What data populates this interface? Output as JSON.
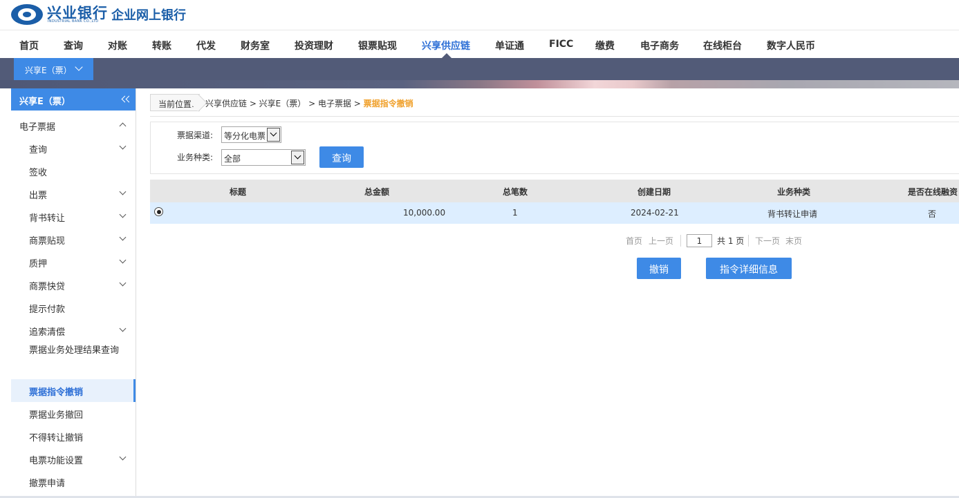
{
  "header": {
    "logo_cn": "兴业银行",
    "logo_en": "INDUSTRIAL BANK CO.,LTD",
    "app_title": "企业网上银行"
  },
  "topnav": {
    "items": [
      "首页",
      "查询",
      "对账",
      "转账",
      "代发",
      "财务室",
      "投资理财",
      "银票贴现",
      "兴享供应链",
      "单证通",
      "FICC",
      "缴费",
      "电子商务",
      "在线柜台",
      "数字人民币"
    ],
    "active": "兴享供应链"
  },
  "subtab": {
    "label": "兴享E（票）"
  },
  "sidebar": {
    "title": "兴享E（票）",
    "items": [
      {
        "label": "电子票据"
      },
      {
        "label": "查询"
      },
      {
        "label": "签收"
      },
      {
        "label": "出票"
      },
      {
        "label": "背书转让"
      },
      {
        "label": "商票贴现"
      },
      {
        "label": "质押"
      },
      {
        "label": "商票快贷"
      },
      {
        "label": "提示付款"
      },
      {
        "label": "追索清偿"
      },
      {
        "label": "票据业务处理结果查询"
      },
      {
        "label": "票据指令撤销"
      },
      {
        "label": "票据业务撤回"
      },
      {
        "label": "不得转让撤销"
      },
      {
        "label": "电票功能设置"
      },
      {
        "label": "撤票申请"
      }
    ]
  },
  "breadcrumb": {
    "label": "当前位置:",
    "path": "兴享供应链 > 兴享E（票） > 电子票据 > ",
    "current": "票据指令撤销"
  },
  "query": {
    "channel_label": "票据渠道:",
    "channel_value": "等分化电票",
    "biztype_label": "业务种类:",
    "biztype_value": "全部",
    "search_button": "查询"
  },
  "table": {
    "columns": [
      "标题",
      "总金额",
      "总笔数",
      "创建日期",
      "业务种类",
      "是否在线融资"
    ],
    "rows": [
      {
        "title": "",
        "amount": "10,000.00",
        "count": "1",
        "date": "2024-02-21",
        "biz_type": "背书转让申请",
        "online_finance": "否"
      }
    ]
  },
  "pager": {
    "first": "首页",
    "prev": "上一页",
    "current_page": "1",
    "total": "共 1 页",
    "next": "下一页",
    "last": "末页"
  },
  "actions": {
    "revoke": "撤销",
    "detail": "指令详细信息"
  },
  "colors": {
    "brand": "#1b5ea8",
    "accent": "#3e8ae6",
    "highlight": "#f0a02a"
  }
}
